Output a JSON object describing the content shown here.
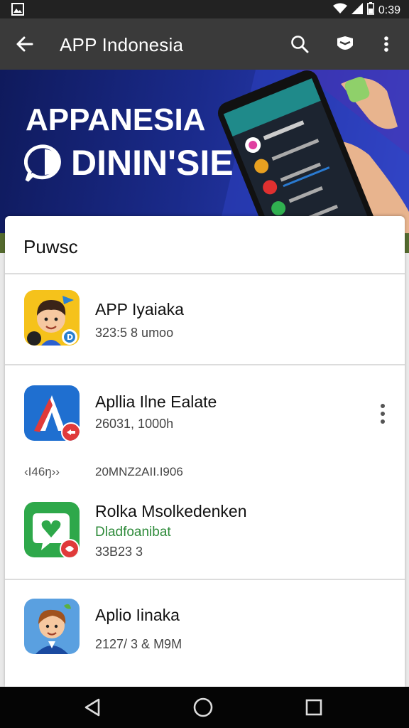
{
  "status_bar": {
    "time": "0:39"
  },
  "app_bar": {
    "title": "APP Indonesia"
  },
  "banner": {
    "line1": "APPANESIA",
    "line2": "DININ'SIE"
  },
  "section": {
    "title": "Puwsc"
  },
  "apps": [
    {
      "name": "APP Iyaiaka",
      "meta": "323:5 8 umoo",
      "icon": "cartoon-boy-icon"
    },
    {
      "name": "Apllia Ilne Ealate",
      "meta": "26031, 1000h",
      "icon": "letter-a-icon"
    },
    {
      "side_label": "‹I46ŋ››",
      "side_value": "20ΜΝΖ2ΑΙΙ.Ι906"
    },
    {
      "name": "Rolka Msolkedenken",
      "green": "Dladfoanibat",
      "meta": "33B23 3",
      "icon": "heart-chat-icon"
    },
    {
      "name": "Aplio Iinaka",
      "meta": "2127/ 3 & M9M",
      "icon": "cartoon-man-icon"
    }
  ],
  "colors": {
    "app_bar": "#3a3a3a",
    "status_bar": "#222222",
    "banner": "#1a2a8a",
    "green_text": "#2e8b3a"
  }
}
